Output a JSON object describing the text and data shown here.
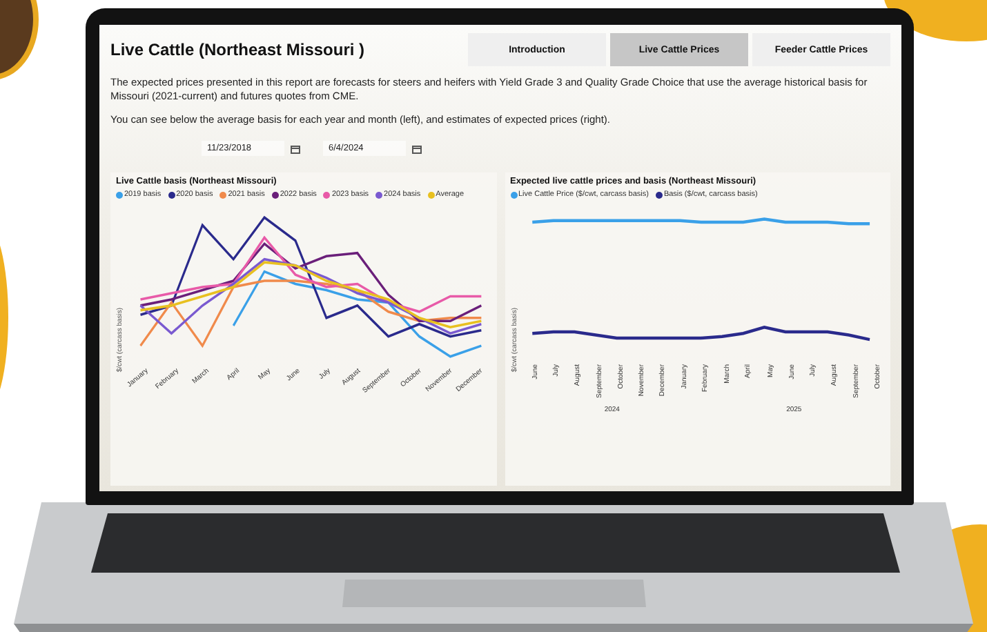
{
  "report": {
    "title": "Live Cattle (Northeast Missouri )",
    "tabs": [
      {
        "label": "Introduction",
        "selected": false
      },
      {
        "label": "Live Cattle Prices",
        "selected": true
      },
      {
        "label": "Feeder Cattle Prices",
        "selected": false
      }
    ],
    "paragraphs": [
      "The expected prices presented in this report are forecasts for steers and heifers with Yield Grade 3 and Quality Grade Choice that use the average historical basis for Missouri (2021-current) and futures quotes from CME.",
      "You can see below the average basis for each year and month (left), and estimates of expected prices (right)."
    ],
    "date_range": {
      "start": "11/23/2018",
      "end": "6/4/2024"
    },
    "charts": [
      {
        "kind": "basis",
        "title": "Live Cattle basis (Northeast Missouri)",
        "ylabel": "$/cwt (carcass basis)",
        "legend": [
          {
            "name": "2019 basis",
            "color": "#3aa0e8"
          },
          {
            "name": "2020 basis",
            "color": "#2a2a8c"
          },
          {
            "name": "2021 basis",
            "color": "#f08a4b"
          },
          {
            "name": "2022 basis",
            "color": "#6a1f7a"
          },
          {
            "name": "2023 basis",
            "color": "#e85aa8"
          },
          {
            "name": "2024 basis",
            "color": "#7a5ad0"
          },
          {
            "name": "Average",
            "color": "#e8c020"
          }
        ],
        "months": [
          "January",
          "February",
          "March",
          "April",
          "May",
          "June",
          "July",
          "August",
          "September",
          "October",
          "November",
          "December"
        ]
      },
      {
        "kind": "forecast",
        "title": "Expected live cattle prices and basis (Northeast Missouri)",
        "ylabel": "$/cwt (carcass basis)",
        "legend": [
          {
            "name": "Live Cattle Price ($/cwt, carcass basis)",
            "color": "#3aa0e8"
          },
          {
            "name": "Basis ($/cwt, carcass basis)",
            "color": "#2a2a8c"
          }
        ],
        "months": [
          "June",
          "July",
          "August",
          "September",
          "October",
          "November",
          "December",
          "January",
          "February",
          "March",
          "April",
          "May",
          "June",
          "July",
          "August",
          "September",
          "October"
        ],
        "years": [
          "2024",
          "2025"
        ]
      }
    ]
  }
}
